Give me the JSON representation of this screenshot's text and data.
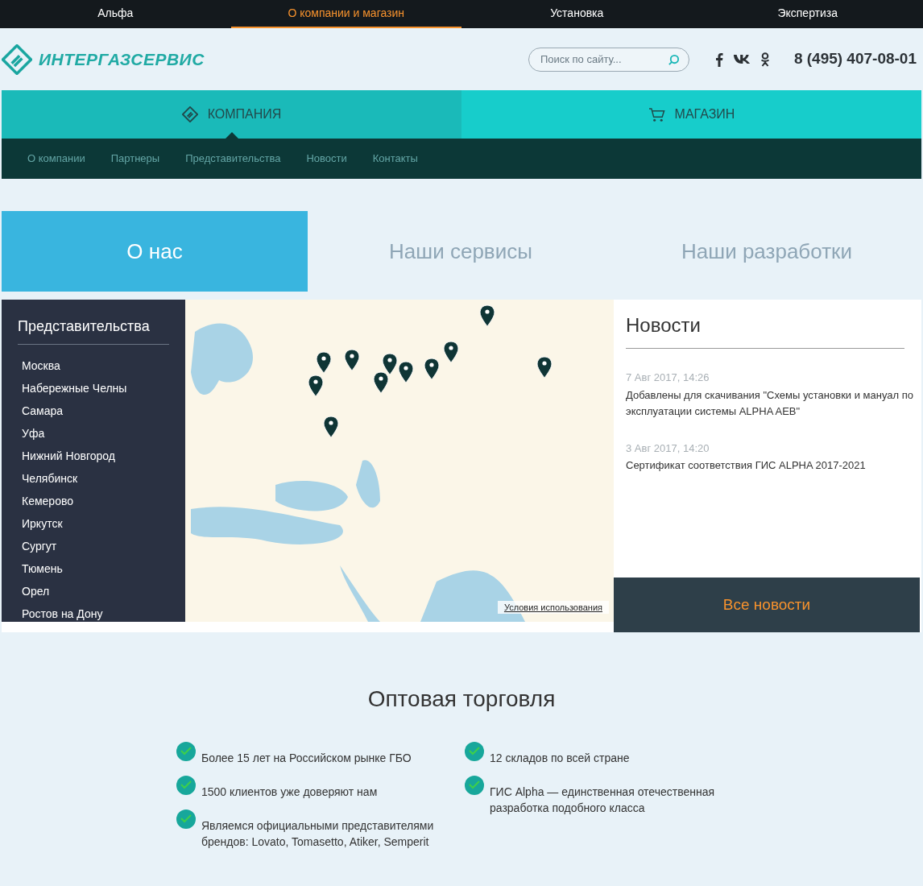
{
  "top_nav": [
    {
      "label": "Альфа",
      "selected": false
    },
    {
      "label": "О компании и магазин",
      "selected": true
    },
    {
      "label": "Установка",
      "selected": false
    },
    {
      "label": "Экспертиза",
      "selected": false
    }
  ],
  "header": {
    "logo_text": "ИНТЕРГАЗСЕРВИС",
    "search": {
      "placeholder": "Поиск по сайту..."
    },
    "phone": "8 (495) 407-08-01"
  },
  "sections": [
    {
      "label": "КОМПАНИЯ",
      "kind": "company",
      "selected": true
    },
    {
      "label": "МАГАЗИН",
      "kind": "shop",
      "selected": false
    }
  ],
  "sub_nav": [
    "О компании",
    "Партнеры",
    "Представительства",
    "Новости",
    "Контакты"
  ],
  "tabs": [
    {
      "label": "О нас",
      "selected": true
    },
    {
      "label": "Наши сервисы",
      "selected": false
    },
    {
      "label": "Наши разработки",
      "selected": false
    }
  ],
  "offices": {
    "title": "Представительства",
    "items": [
      "Москва",
      "Набережные Челны",
      "Самара",
      "Уфа",
      "Нижний Новгород",
      "Челябинск",
      "Кемерово",
      "Иркутск",
      "Сургут",
      "Тюмень",
      "Орел",
      "Ростов на Дону"
    ]
  },
  "map": {
    "terms_link": "Условия использования"
  },
  "news": {
    "title": "Новости",
    "items": [
      {
        "date": "7 Авг 2017, 14:26",
        "text": "Добавлены для скачивания \"Схемы установки и мануал по эксплуатации системы ALPHA AEB\""
      },
      {
        "date": "3 Авг 2017, 14:20",
        "text": "Сертификат соответствия  ГИС ALPHA 2017-2021"
      }
    ],
    "all_button": "Все новости"
  },
  "wholesale": {
    "title": "Оптовая торговля",
    "columns": [
      [
        "Более 15 лет на Российском рынке ГБО",
        "1500 клиентов уже доверяют нам",
        "Являемся официальными представителями брендов: Lovato, Tomasetto, Atiker, Semperit"
      ],
      [
        "12 складов по всей стране",
        "ГИС Alpha — единственная отечественная разработка подобного класса"
      ]
    ]
  }
}
